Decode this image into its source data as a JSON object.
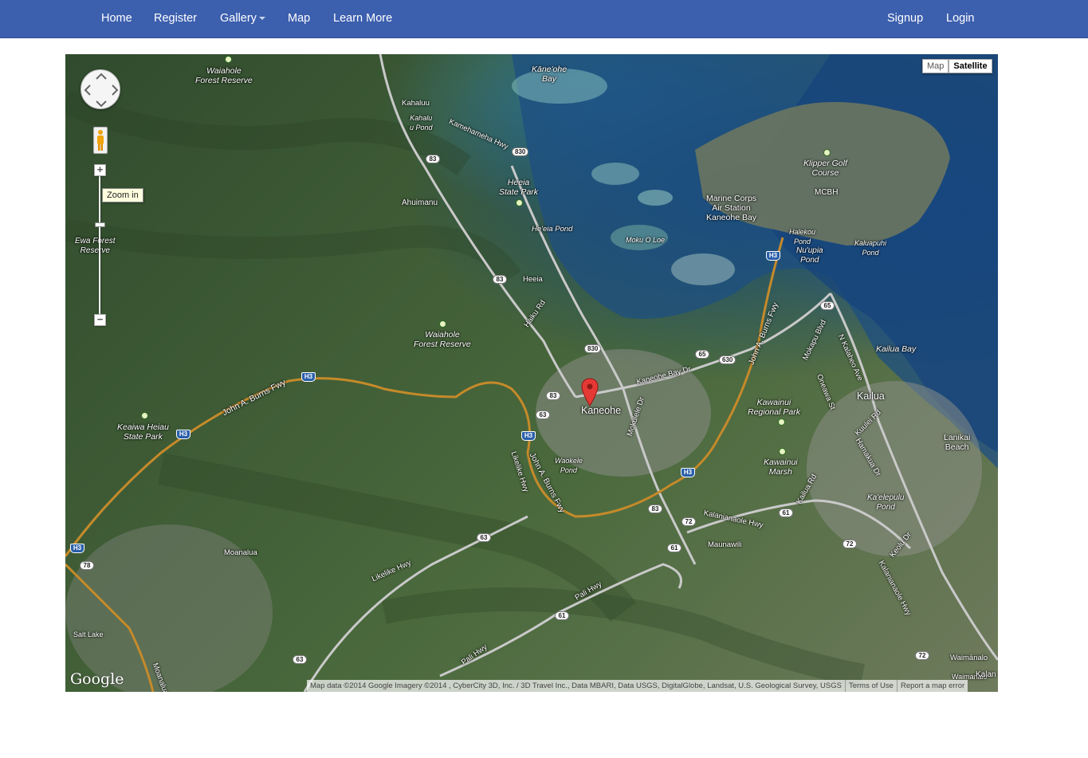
{
  "nav": {
    "left": [
      "Home",
      "Register",
      "Gallery",
      "Map",
      "Learn More"
    ],
    "right": [
      "Signup",
      "Login"
    ]
  },
  "map": {
    "type_buttons": {
      "map": "Map",
      "satellite": "Satellite"
    },
    "tooltip": "Zoom in",
    "zoom_in": "+",
    "zoom_out": "−",
    "logo": "Google",
    "attribution": {
      "data": "Map data ©2014 Google Imagery ©2014 , CyberCity 3D, Inc. / 3D Travel Inc., Data MBARI, Data USGS, DigitalGlobe, Landsat, U.S. Geological Survey, USGS",
      "terms": "Terms of Use",
      "report": "Report a map error"
    },
    "marker_label": "Kaneohe",
    "places": {
      "waiahole_north": "Waiahole\nForest Reserve",
      "kaneohe_bay": "Kāne'ohe\nBay",
      "kahaluu": "Kahaluu",
      "kahaluu_pond": "Kahalu\nu Pond",
      "kamehameha_hwy": "Kamehameha Hwy",
      "heeia_state_park": "Heeia\nState Park",
      "ahuimanu": "Ahuimanu",
      "heeia_pond": "He'eia Pond",
      "moku_o_loe": "Moku O Loe",
      "heeia": "Heeia",
      "haiku_rd": "Haiku Rd",
      "marine_corps": "Marine Corps\nAir Station\nKaneohe Bay",
      "klipper": "Klipper Golf\nCourse",
      "mcbh": "MCBH",
      "halekou": "Halekou\nPond",
      "nuupia": "Nu'upia\nPond",
      "kaluapuhi": "Kaluapuhi\nPond",
      "ewa_forest": "Ewa Forest\nReserve",
      "waiahole_mid": "Waiahole\nForest Reserve",
      "john_a_burns_west": "John A. Burns Fwy",
      "john_a_burns_east": "John A. Burns Fwy",
      "john_a_burns_south": "John A. Burns Fwy",
      "kaneohe_bay_dr": "Kaneohe Bay Dr",
      "mokapu_blvd": "Mokapu Blvd",
      "n_kalaheo": "N Kalaheo Ave",
      "kailua_bay": "Kailua Bay",
      "oneawa": "Oneawa St",
      "kailua": "Kailua",
      "kuulei": "Kuulei Rd",
      "kawainui_park": "Kawainui\nRegional Park",
      "lanikai": "Lanikai\nBeach",
      "keaiwa": "Keaiwa Heiau\nState Park",
      "mokulele": "Mokulele Dr",
      "waokele": "Waokele\nPond",
      "likelike_north": "Likelike Hwy",
      "kawainui_marsh": "Kawainui\nMarsh",
      "hamakua": "Hamakua Dr",
      "kailua_rd": "Kailua Rd",
      "kaelepulu": "Ka'elepulu\nPond",
      "kalanianaole": "Kalanianaole Hwy",
      "kalanianaole_south": "Kalanianaole Hwy",
      "maunawili": "Maunawili",
      "keolu": "Keolu Dr",
      "moanalua": "Moanalua",
      "likelike_south": "Likelike Hwy",
      "pali_hwy_north": "Pali Hwy",
      "pali_hwy_south": "Pali Hwy",
      "salt_lake": "Salt Lake",
      "moanalua_fwy": "Moanalua F",
      "waimanalo": "Waimānalo",
      "waimanalo_beach": "Waimanalo",
      "kalan": "Kalan"
    },
    "shields": {
      "r830a": "830",
      "r830b": "830",
      "r83a": "83",
      "r83b": "83",
      "r83c": "83",
      "r83d": "83",
      "r63a": "63",
      "r63b": "63",
      "r63c": "63",
      "r65a": "65",
      "r65b": "65",
      "r630": "630",
      "r61a": "61",
      "r61b": "61",
      "r61c": "61",
      "r72a": "72",
      "r72b": "72",
      "r72c": "72",
      "r78": "78"
    },
    "h3": "H3"
  }
}
